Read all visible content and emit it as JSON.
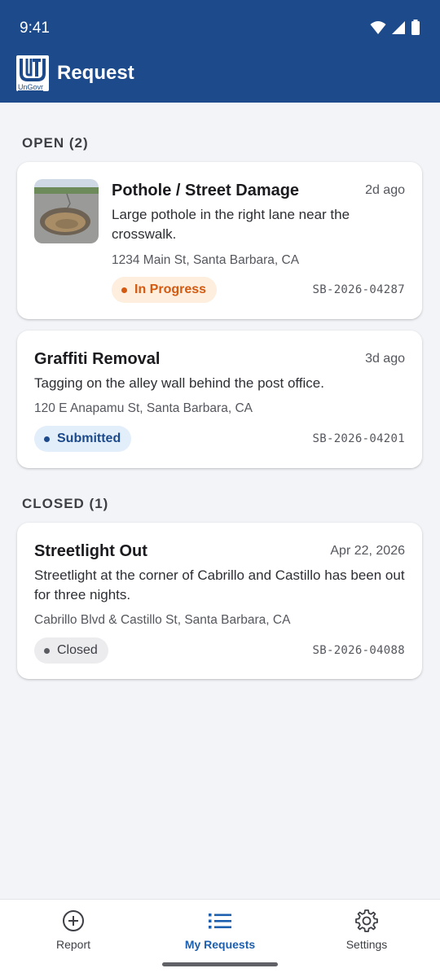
{
  "status_bar": {
    "time": "9:41"
  },
  "app_bar": {
    "logo_text": "UnGovr",
    "title": "Request"
  },
  "sections": {
    "open": {
      "header": "OPEN (2)",
      "requests": [
        {
          "title": "Pothole / Street Damage",
          "time": "2d ago",
          "description": "Large pothole in the right lane near the crosswalk.",
          "address": "1234 Main St, Santa Barbara, CA",
          "status": "In Progress",
          "reference": "SB-2026-04287"
        },
        {
          "title": "Graffiti Removal",
          "time": "3d ago",
          "description": "Tagging on the alley wall behind the post office.",
          "address": "120 E Anapamu St, Santa Barbara, CA",
          "status": "Submitted",
          "reference": "SB-2026-04201"
        }
      ]
    },
    "closed": {
      "header": "CLOSED (1)",
      "requests": [
        {
          "title": "Streetlight Out",
          "time": "Apr 22, 2026",
          "description": "Streetlight at the corner of Cabrillo and Castillo has been out for three nights.",
          "address": "Cabrillo Blvd & Castillo St, Santa Barbara, CA",
          "status": "Closed",
          "reference": "SB-2026-04088"
        }
      ]
    }
  },
  "bottom_nav": {
    "items": [
      {
        "label": "Report",
        "icon": "plus-circle-icon"
      },
      {
        "label": "My Requests",
        "icon": "list-icon",
        "active": true
      },
      {
        "label": "Settings",
        "icon": "gear-icon"
      }
    ]
  },
  "colors": {
    "primary": "#1c4a8a",
    "accent": "#1c5fae",
    "in_progress": "#d35a10",
    "background": "#f2f4f8"
  }
}
